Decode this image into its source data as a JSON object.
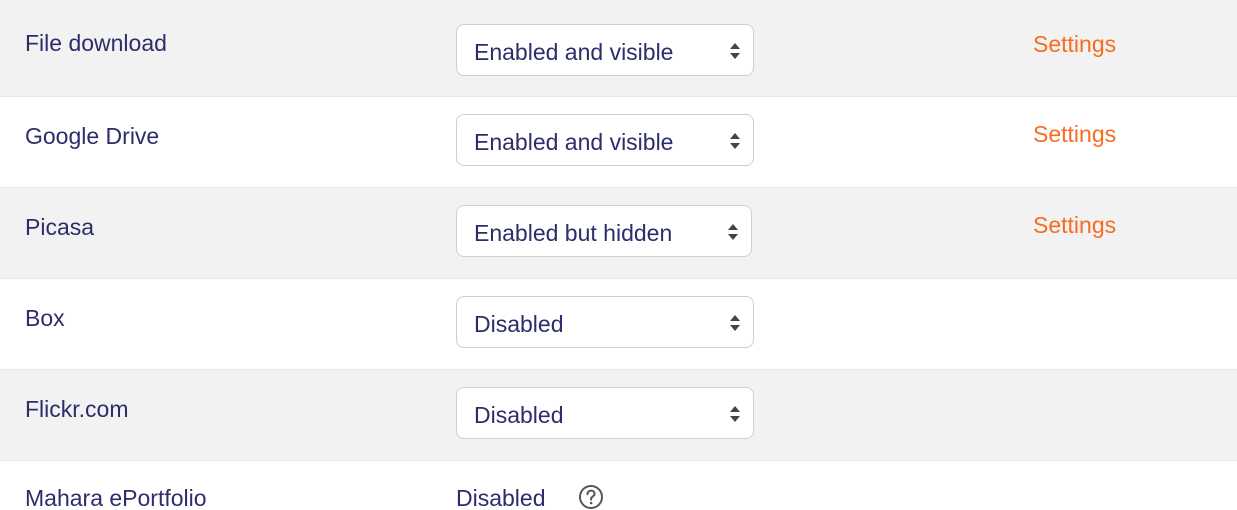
{
  "repositories": [
    {
      "name": "File download",
      "visibility": "Enabled and visible",
      "settings_label": "Settings"
    },
    {
      "name": "Google Drive",
      "visibility": "Enabled and visible",
      "settings_label": "Settings"
    },
    {
      "name": "Picasa",
      "visibility": "Enabled but hidden",
      "settings_label": "Settings"
    },
    {
      "name": "Box",
      "visibility": "Disabled",
      "settings_label": ""
    },
    {
      "name": "Flickr.com",
      "visibility": "Disabled",
      "settings_label": ""
    },
    {
      "name": "Mahara ePortfolio",
      "visibility": "Disabled",
      "settings_label": "",
      "help_icon": "question-circle-icon"
    }
  ],
  "colors": {
    "label": "#2d2d6b",
    "link": "#f66d21",
    "stripe": "#f2f2f2"
  }
}
